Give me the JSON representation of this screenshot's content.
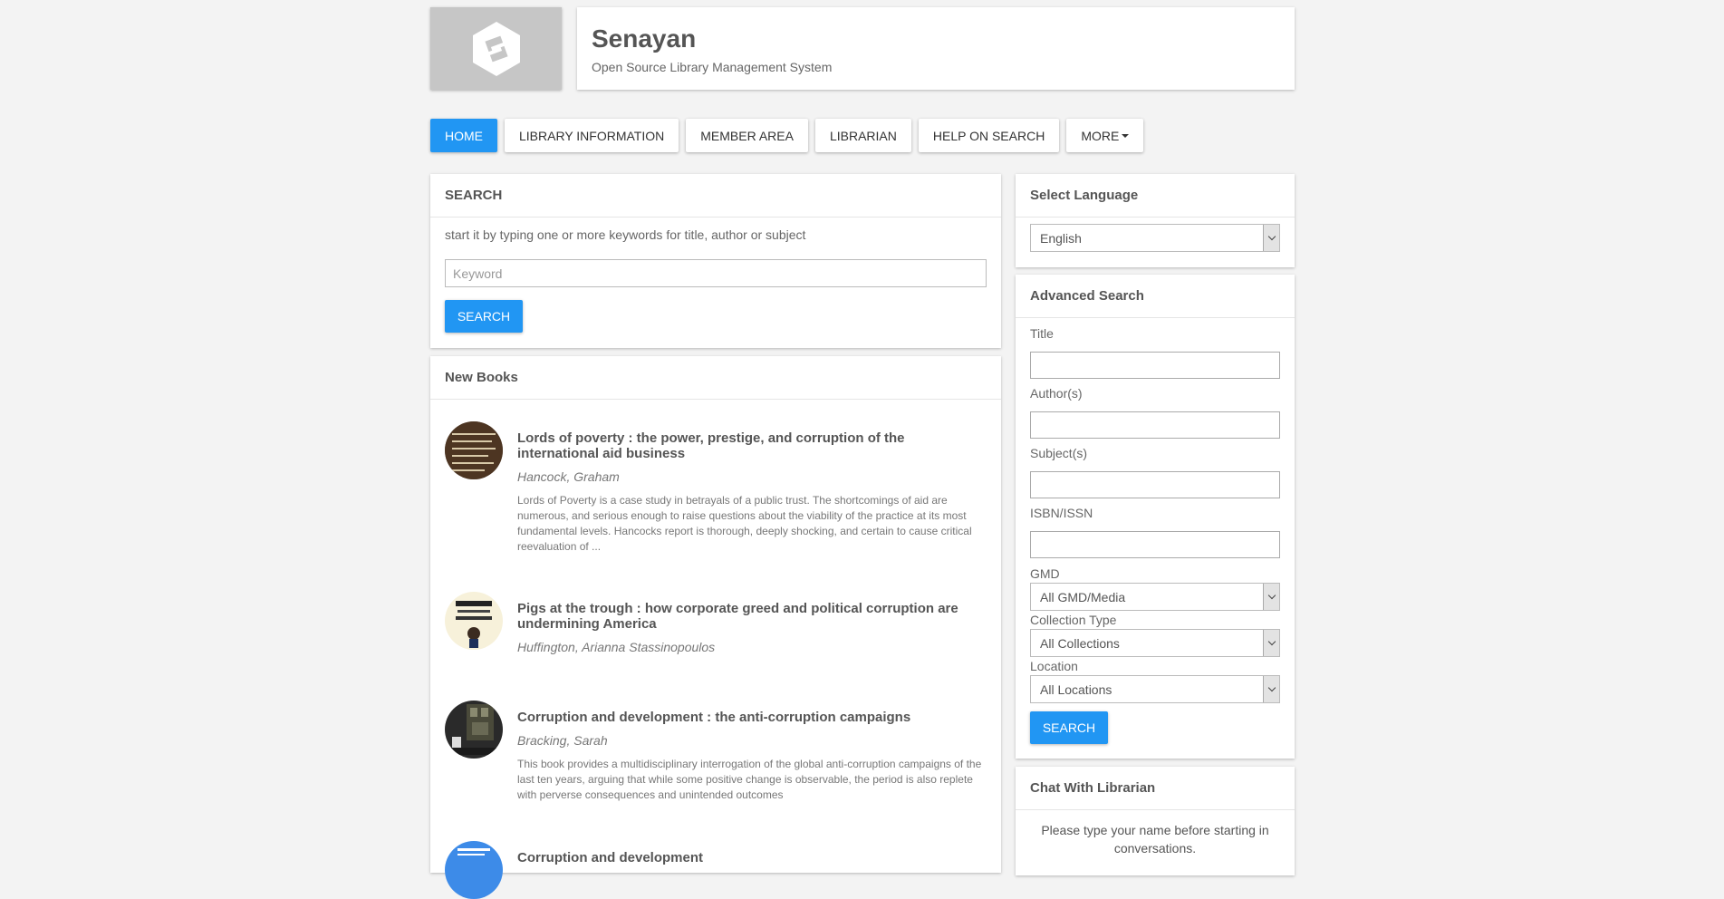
{
  "header": {
    "logo": "senayan-logo-icon",
    "title": "Senayan",
    "subtitle": "Open Source Library Management System"
  },
  "nav": {
    "items": [
      {
        "label": "HOME",
        "active": true
      },
      {
        "label": "LIBRARY INFORMATION"
      },
      {
        "label": "MEMBER AREA"
      },
      {
        "label": "LIBRARIAN"
      },
      {
        "label": "HELP ON SEARCH"
      },
      {
        "label": "MORE"
      }
    ]
  },
  "search": {
    "heading": "SEARCH",
    "hint": "start it by typing one or more keywords for title, author or subject",
    "placeholder": "Keyword",
    "button": "SEARCH"
  },
  "new_books": {
    "heading": "New Books",
    "items": [
      {
        "title": "Lords of poverty : the power, prestige, and corruption of the international aid business",
        "author": "Hancock, Graham",
        "description": "Lords of Poverty is a case study in betrayals of a public trust. The shortcomings of aid are numerous, and serious enough to raise questions about the viability of the practice at its most fundamental levels. Hancocks report is thorough, deeply shocking, and certain to cause critical reevaluation of ..."
      },
      {
        "title": "Pigs at the trough : how corporate greed and political corruption are undermining America",
        "author": "Huffington, Arianna Stassinopoulos",
        "description": ""
      },
      {
        "title": "Corruption and development : the anti-corruption campaigns",
        "author": "Bracking, Sarah",
        "description": "This book provides a multidisciplinary interrogation of the global anti-corruption campaigns of the last ten years, arguing that while some positive change is observable, the period is also replete with perverse consequences and unintended outcomes"
      },
      {
        "title": "Corruption and development",
        "author": "",
        "description": ""
      }
    ]
  },
  "language": {
    "heading": "Select Language",
    "selected": "English"
  },
  "advanced": {
    "heading": "Advanced Search",
    "title_label": "Title",
    "author_label": "Author(s)",
    "subject_label": "Subject(s)",
    "isbn_label": "ISBN/ISSN",
    "gmd_label": "GMD",
    "gmd_value": "All GMD/Media",
    "collection_label": "Collection Type",
    "collection_value": "All Collections",
    "location_label": "Location",
    "location_value": "All Locations",
    "button": "SEARCH"
  },
  "chat": {
    "heading": "Chat With Librarian",
    "text": "Please type your name before starting in conversations."
  },
  "colors": {
    "accent": "#2196f3",
    "background": "#f3f3f3",
    "logo_bg": "#c6c6c6"
  }
}
